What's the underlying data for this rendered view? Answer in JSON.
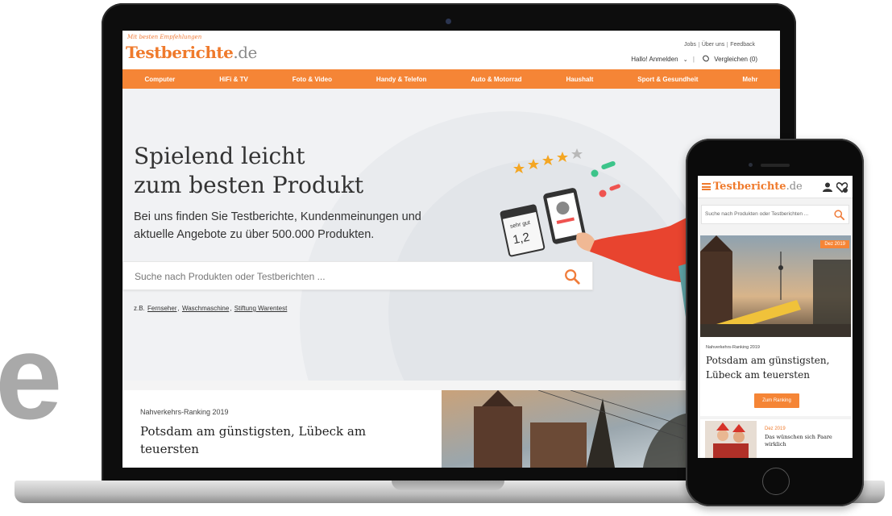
{
  "background": {
    "letter": "e"
  },
  "site": {
    "tagline": "Mit besten Empfehlungen",
    "logo_main": "Testberichte",
    "logo_tld": ".de",
    "top_links": [
      "Jobs",
      "Über uns",
      "Feedback"
    ],
    "login": "Hallo! Anmelden",
    "compare": "Vergleichen (0)",
    "brand_color": "#f58536"
  },
  "nav": [
    "Computer",
    "HiFi & TV",
    "Foto & Video",
    "Handy & Telefon",
    "Auto & Motorrad",
    "Haushalt",
    "Sport & Gesundheit",
    "Mehr"
  ],
  "hero": {
    "title_line1": "Spielend leicht",
    "title_line2": "zum besten Produkt",
    "subtitle": "Bei uns finden Sie Testberichte, Kundenmeinungen und aktuelle Angebote zu über 500.000 Produkten.",
    "search_placeholder": "Suche nach Produkten oder Testberichten ...",
    "examples_prefix": "z.B.",
    "examples": [
      "Fernseher",
      "Waschmaschine",
      "Stiftung Warentest"
    ],
    "grade_card": "sehr gut 1,2"
  },
  "article": {
    "kicker": "Nahverkehrs-Ranking 2019",
    "title": "Potsdam am günstigsten, Lübeck am teuersten"
  },
  "phone": {
    "logo_main": "Testberichte",
    "logo_tld": ".de",
    "search_placeholder": "Suche nach Produkten oder Testberichten ...",
    "badge": "Dez 2019",
    "kicker": "Nahverkehrs-Ranking 2019",
    "title": "Potsdam am günstigsten, Lübeck am teuersten",
    "cta": "Zum Ranking",
    "card2_date": "Dez 2019",
    "card2_title": "Das wünschen sich Paare wirklich"
  }
}
